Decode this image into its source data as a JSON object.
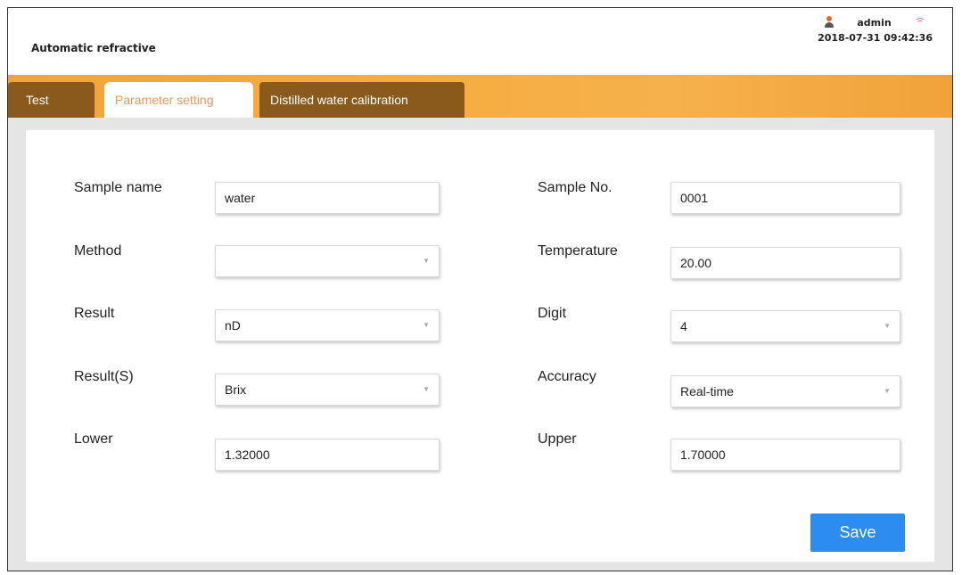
{
  "app": {
    "title": "Automatic refractive",
    "user": "admin",
    "datetime": "2018-07-31 09:42:36"
  },
  "tabs": [
    {
      "label": "Test"
    },
    {
      "label": "Parameter setting"
    },
    {
      "label": "Distilled water calibration"
    }
  ],
  "active_tab": "Parameter setting",
  "form": {
    "sample_name": {
      "label": "Sample name",
      "value": "water"
    },
    "sample_no": {
      "label": "Sample No.",
      "value": "0001"
    },
    "method": {
      "label": "Method",
      "value": ""
    },
    "temperature": {
      "label": "Temperature",
      "value": "20.00"
    },
    "result": {
      "label": "Result",
      "value": "nD"
    },
    "digit": {
      "label": "Digit",
      "value": "4"
    },
    "result_s": {
      "label": "Result(S)",
      "value": "Brix"
    },
    "accuracy": {
      "label": "Accuracy",
      "value": "Real-time"
    },
    "lower": {
      "label": "Lower",
      "value": "1.32000"
    },
    "upper": {
      "label": "Upper",
      "value": "1.70000"
    },
    "save_label": "Save"
  },
  "colors": {
    "accent": "#f6ac3f",
    "tab_dark": "#8a5a1c",
    "active_tab_text": "#e59a59",
    "save_button": "#2d8cf0"
  }
}
